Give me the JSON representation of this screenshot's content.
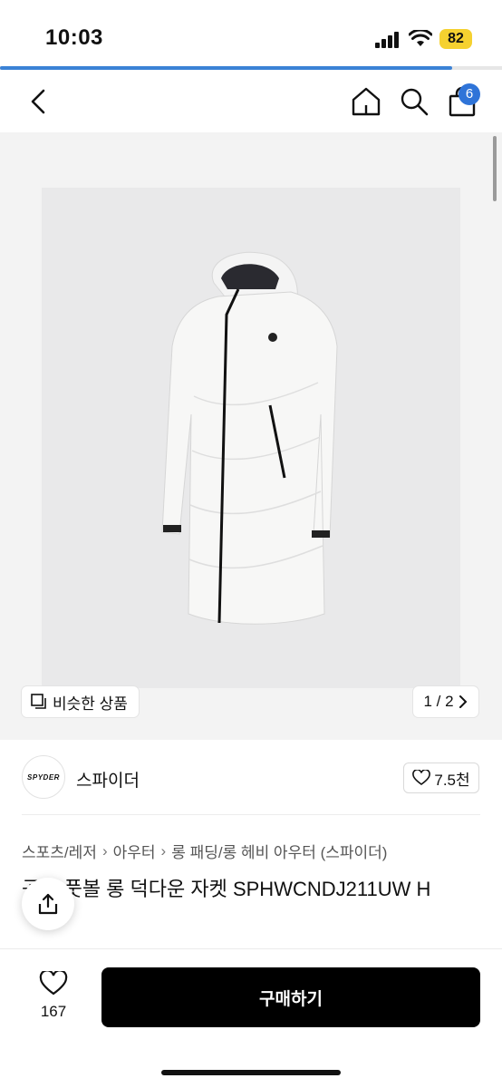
{
  "status": {
    "time": "10:03",
    "battery": "82"
  },
  "progress": {
    "fraction": 0.9
  },
  "nav": {
    "cart_count": "6"
  },
  "gallery": {
    "similar_label": "비슷한 상품",
    "pager": "1 / 2"
  },
  "brand": {
    "logo_text": "SPYDER",
    "name": "스파이더",
    "likes": "7.5천"
  },
  "breadcrumb": [
    "스포츠/레저",
    "아우터",
    "롱 패딩/롱 헤비 아우터 (스파이더)"
  ],
  "product": {
    "title": "공용 풋볼 롱 덕다운 자켓 SPHWCNDJ211UW H"
  },
  "bottom": {
    "wish_count": "167",
    "buy_label": "구매하기"
  },
  "colors": {
    "accent": "#2f74d8",
    "battery": "#f5d130",
    "buy": "#000000"
  }
}
